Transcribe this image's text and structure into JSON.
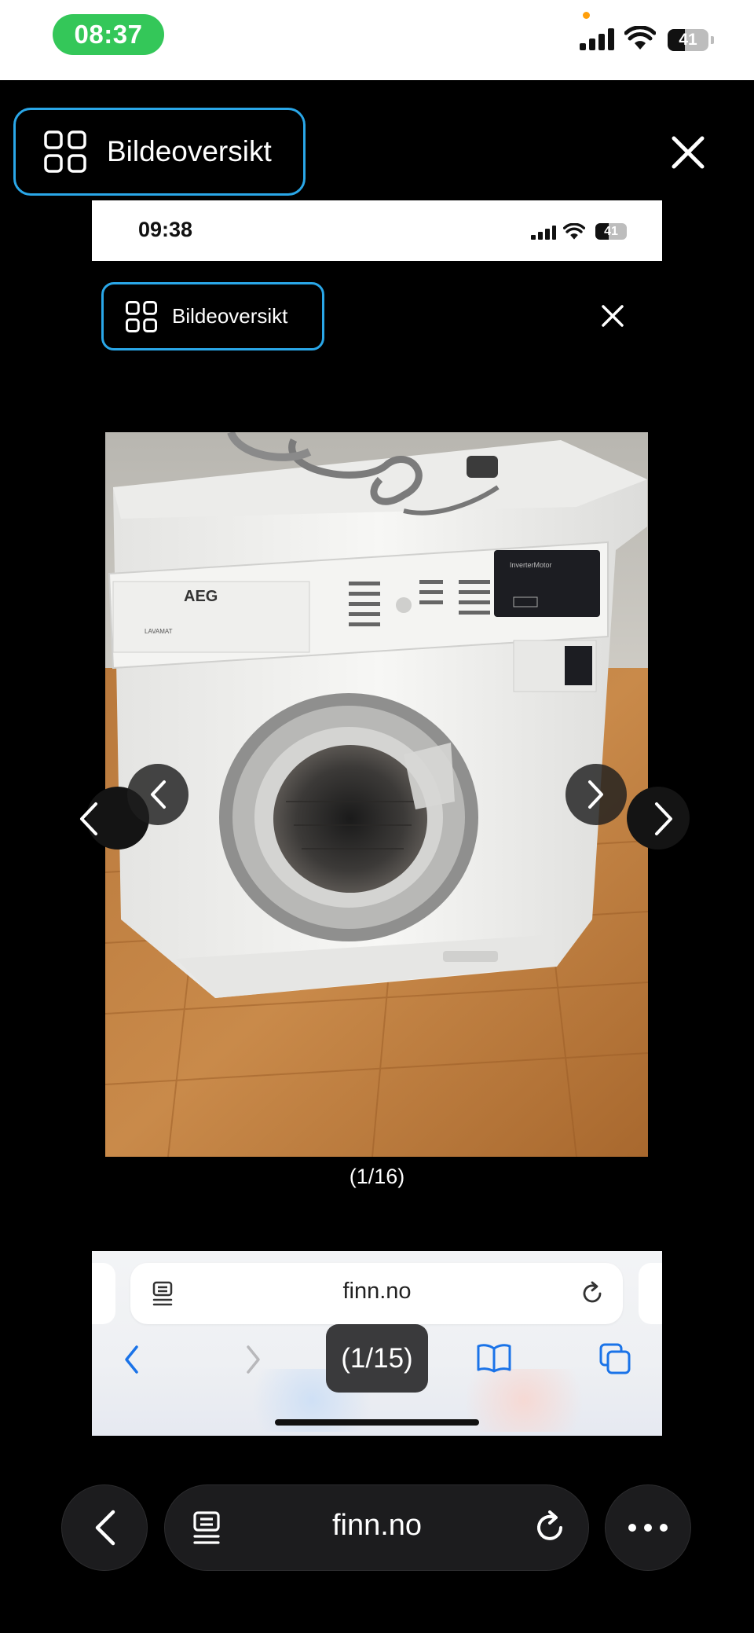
{
  "status_bar": {
    "time": "08:37",
    "battery": "41"
  },
  "viewer": {
    "overview_label": "Bildeoversikt",
    "close_icon": "close-icon"
  },
  "embedded_screenshot": {
    "status_time": "09:38",
    "battery": "41",
    "overview_label": "Bildeoversikt",
    "image_counter": "(1/16)",
    "browser": {
      "url": "finn.no",
      "tab_counter": "(1/15)"
    }
  },
  "photo": {
    "subject": "AEG washing machine",
    "brand_text": "AEG",
    "model_text": "LAVAMAT",
    "panel_text": "InverterMotor"
  },
  "browser": {
    "url": "finn.no",
    "icons": [
      "back-icon",
      "reader-icon",
      "reload-icon",
      "more-icon"
    ]
  },
  "colors": {
    "accent": "#2aa7e8",
    "time_pill": "#34c759",
    "background": "#000000"
  }
}
